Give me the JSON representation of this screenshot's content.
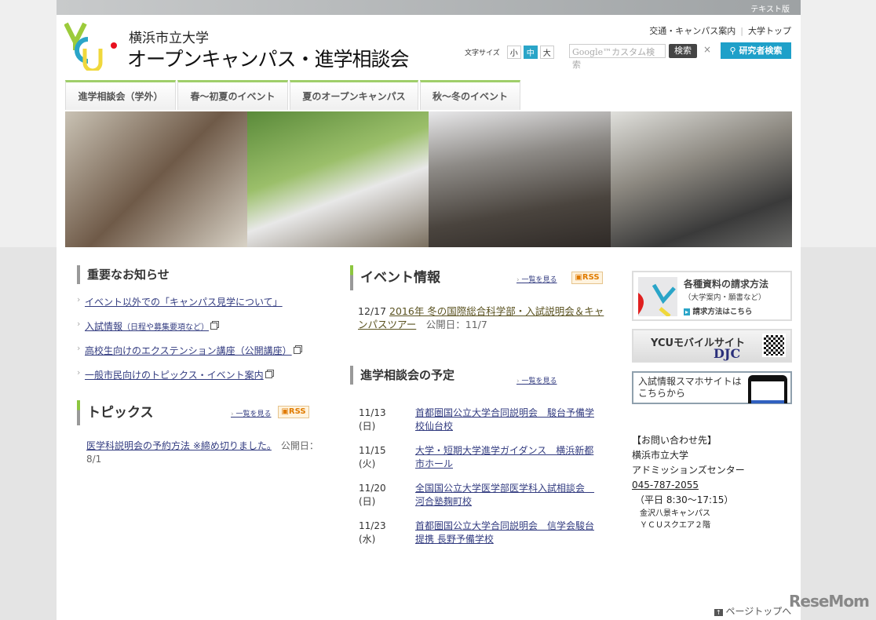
{
  "header": {
    "text_version": "テキスト版",
    "university": "横浜市立大学",
    "site_title": "オープンキャンパス・進学相談会",
    "logo_text": "YCU",
    "top_links": [
      "交通・キャンパス案内",
      "大学トップ"
    ],
    "font_size_label": "文字サイズ",
    "font_sizes": [
      "小",
      "中",
      "大"
    ],
    "search_placeholder": "Google™カスタム検索",
    "search_button": "検索",
    "clear": "×",
    "researcher_search": "研究者検索"
  },
  "nav": [
    "進学相談会（学外）",
    "春～初夏のイベント",
    "夏のオープンキャンパス",
    "秋～冬のイベント"
  ],
  "notices": {
    "title": "重要なお知らせ",
    "items": [
      "イベント以外での「キャンパス見学について」",
      "入試情報",
      "（日程や募集要項など）",
      "高校生向けのエクステンション講座（公開講座）",
      "一般市民向けのトピックス・イベント案内"
    ]
  },
  "topics": {
    "title": "トピックス",
    "more": "一覧を見る",
    "rss": "RSS",
    "item": "医学科説明会の予約方法 ※締め切りました。",
    "published": "公開日：8/1"
  },
  "events": {
    "title": "イベント情報",
    "more": "一覧を見る",
    "rss": "RSS",
    "date": "12/17",
    "item": "2016年 冬の国際総合科学部・入試説明会＆キャンパスツアー",
    "published": "公開日：11/7"
  },
  "schedule": {
    "title": "進学相談会の予定",
    "more": "一覧を見る",
    "items": [
      {
        "date": "11/13",
        "day": "(日)",
        "title": "首都圏国公立大学合同説明会　駿台予備学校仙台校"
      },
      {
        "date": "11/15",
        "day": "(火)",
        "title": "大学・短期大学進学ガイダンス　横浜新都市ホール"
      },
      {
        "date": "11/20",
        "day": "(日)",
        "title": "全国国公立大学医学部医学科入試相談会　河合塾麹町校"
      },
      {
        "date": "11/23",
        "day": "(水)",
        "title": "首都圏国公立大学合同説明会　信学会駿台提携 長野予備学校"
      }
    ]
  },
  "sidebar": {
    "materials_title": "各種資料の請求方法",
    "materials_sub": "（大学案内・願書など）",
    "materials_link": "請求方法はこちら",
    "mobile": "YCUモバイルサイト",
    "djc": "DJC",
    "smartphone": "入試情報スマホサイトはこちらから",
    "contact": {
      "heading": "【お問い合わせ先】",
      "org": "横浜市立大学",
      "dept": "アドミッションズセンター",
      "phone": "045-787-2055",
      "hours": "（平日 8:30～17:15）",
      "campus": "金沢八景キャンパス",
      "building": "ＹＣＵスクエア２階"
    }
  },
  "footer": {
    "page_top": "ページトップへ",
    "watermark": "ReseMom"
  }
}
